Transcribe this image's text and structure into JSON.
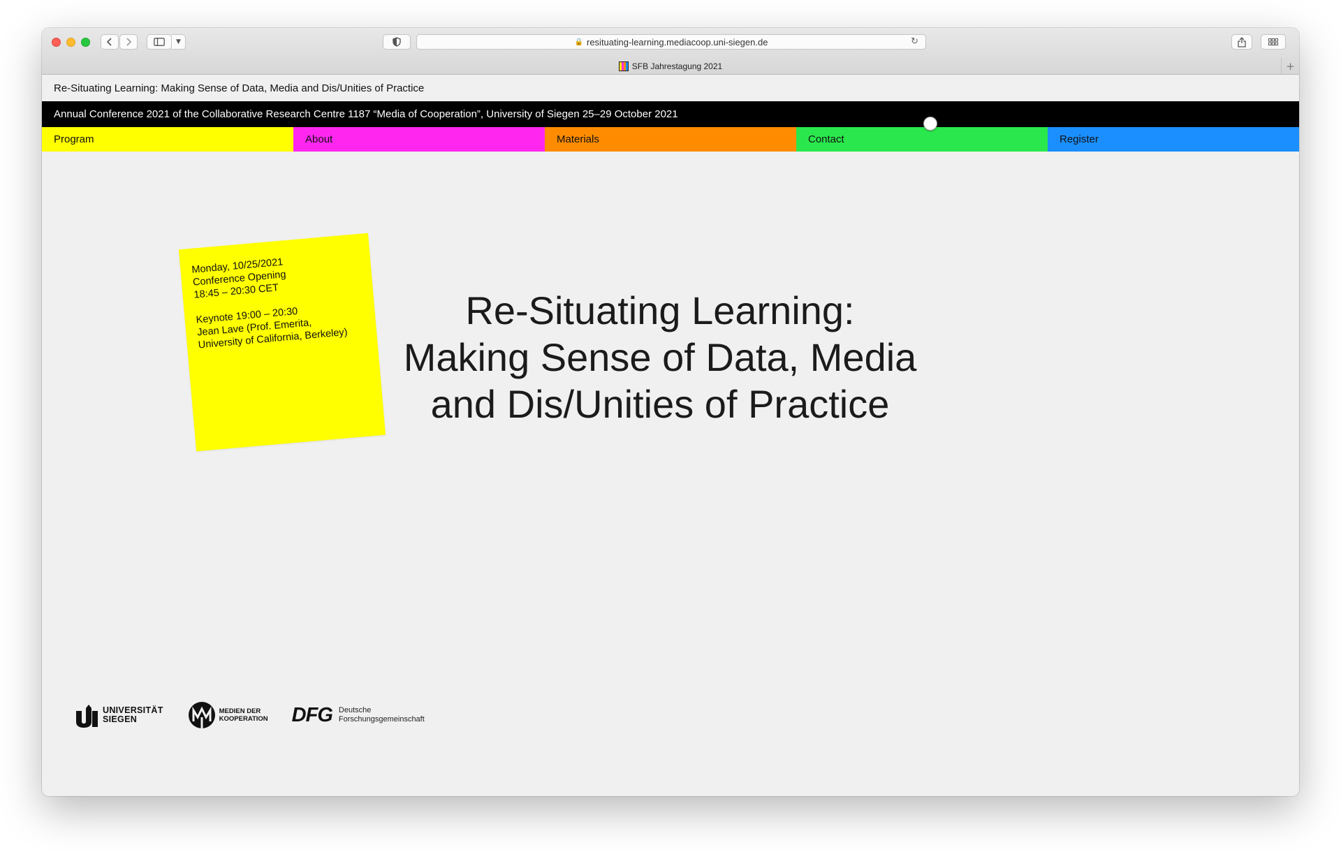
{
  "browser": {
    "url": "resituating-learning.mediacoop.uni-siegen.de",
    "tab_title": "SFB Jahrestagung 2021",
    "icons": {
      "back": "chevron-left-icon",
      "forward": "chevron-right-icon",
      "sidebar": "sidebar-icon",
      "shield": "shield-icon",
      "lock": "lock-icon",
      "reload": "reload-icon",
      "share": "share-icon",
      "tabs": "tab-overview-icon",
      "new_tab": "plus-icon"
    }
  },
  "site": {
    "title": "Re-Situating Learning: Making Sense of Data, Media and Dis/Unities of Practice",
    "subtitle": "Annual Conference 2021 of the Collaborative Research Centre 1187 “Media of Cooperation”, University of Siegen 25–29 October 2021"
  },
  "nav": {
    "program": "Program",
    "about": "About",
    "materials": "Materials",
    "contact": "Contact",
    "register": "Register",
    "colors": {
      "program": "#ffff00",
      "about": "#ff27f0",
      "materials": "#ff8c00",
      "contact": "#2ae74d",
      "register": "#1b8fff"
    }
  },
  "note": {
    "line1": "Monday, 10/25/2021",
    "line2": "Conference Opening",
    "line3": "18:45 – 20:30 CET",
    "line4": "Keynote 19:00 – 20:30",
    "line5": "Jean Lave (Prof. Emerita,",
    "line6": "University of California, Berkeley)"
  },
  "hero": {
    "line1": "Re-Situating Learning:",
    "line2": "Making Sense of Data, Media",
    "line3": "and Dis/Unities of Practice"
  },
  "logos": {
    "uni_line1": "UNIVERSITÄT",
    "uni_line2": "SIEGEN",
    "mdk_line1": "MEDIEN DER",
    "mdk_line2": "KOOPERATION",
    "dfg_mark": "DFG",
    "dfg_line1": "Deutsche",
    "dfg_line2": "Forschungsgemeinschaft"
  }
}
